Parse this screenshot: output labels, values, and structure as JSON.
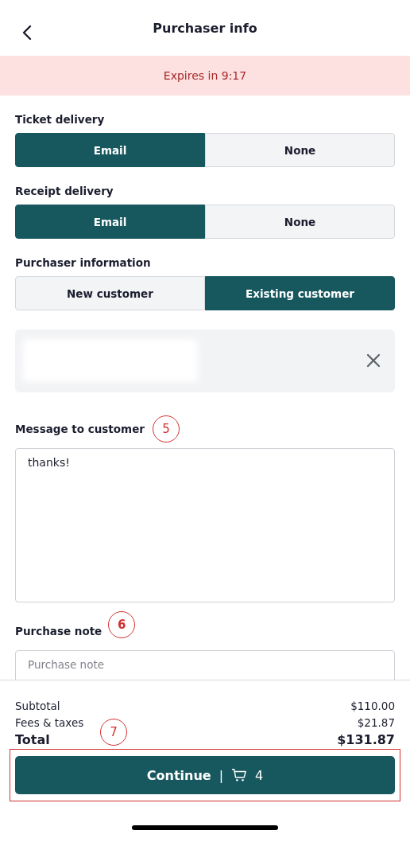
{
  "header": {
    "title": "Purchaser info"
  },
  "banner": {
    "text": "Expires in 9:17"
  },
  "segments": [
    {
      "label": "Ticket delivery",
      "options": [
        {
          "label": "Email",
          "selected": true
        },
        {
          "label": "None",
          "selected": false
        }
      ]
    },
    {
      "label": "Receipt delivery",
      "options": [
        {
          "label": "Email",
          "selected": true
        },
        {
          "label": "None",
          "selected": false
        }
      ]
    },
    {
      "label": "Purchaser information",
      "options": [
        {
          "label": "New customer",
          "selected": false
        },
        {
          "label": "Existing customer",
          "selected": true
        }
      ]
    }
  ],
  "customer_card": {
    "redacted": true
  },
  "message": {
    "label": "Message to customer",
    "annotation": "5",
    "value": "thanks!"
  },
  "purchase_note": {
    "label": "Purchase note",
    "annotation": "6",
    "placeholder": "Purchase note"
  },
  "summary": [
    {
      "label": "Subtotal",
      "value": "$110.00",
      "kind": "line"
    },
    {
      "label": "Fees & taxes",
      "value": "$21.87",
      "kind": "line"
    },
    {
      "label": "Total",
      "value": "$131.87",
      "kind": "total"
    }
  ],
  "summary_annotation": "7",
  "continue_button": {
    "label": "Continue",
    "separator": "|",
    "count": "4",
    "highlighted": true
  }
}
